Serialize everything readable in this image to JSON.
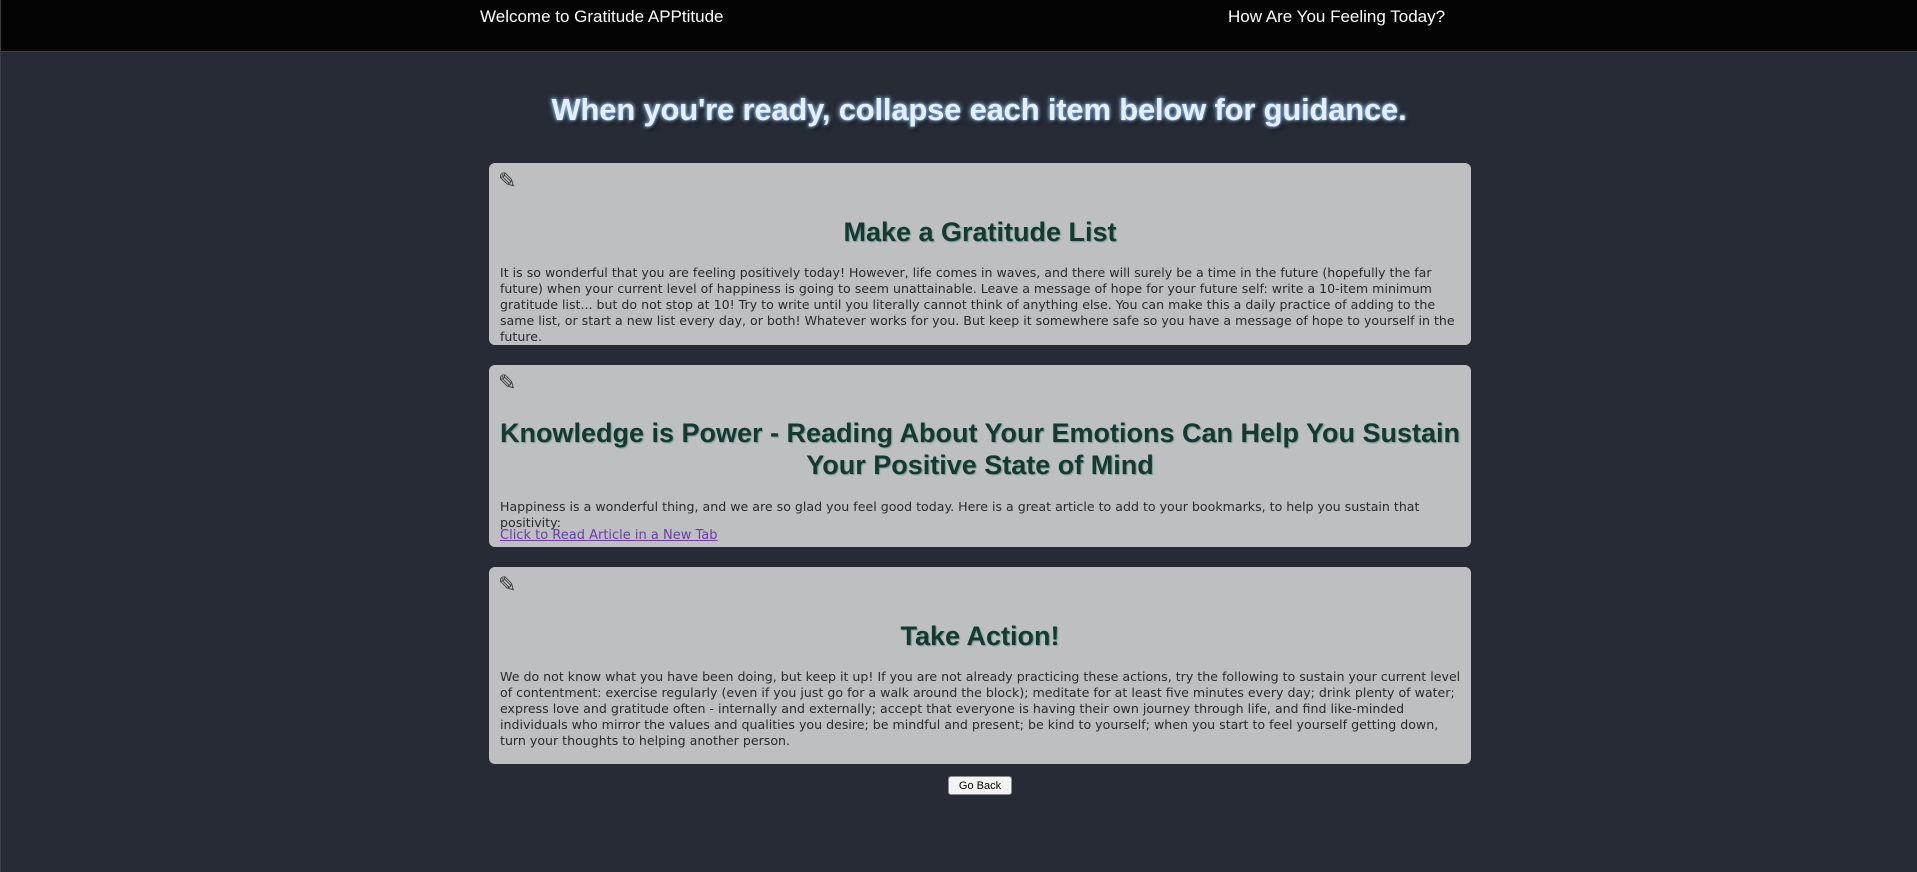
{
  "nav": {
    "home_label": "Welcome to Gratitude APPtitude",
    "feeling_label": "How Are You Feeling Today?"
  },
  "headline": "When you're ready, collapse each item below for guidance.",
  "icons": {
    "card_toggle": "pencil-icon"
  },
  "cards": [
    {
      "title": "Make a Gratitude List",
      "body": "It is so wonderful that you are feeling positively today! However, life comes in waves, and there will surely be a time in the future (hopefully the far future) when your current level of happiness is going to seem unattainable. Leave a message of hope for your future self: write a 10-item minimum gratitude list... but do not stop at 10! Try to write until you literally cannot think of anything else. You can make this a daily practice of adding to the same list, or start a new list every day, or both! Whatever works for you. But keep it somewhere safe so you have a message of hope to yourself in the future."
    },
    {
      "title": "Knowledge is Power - Reading About Your Emotions Can Help You Sustain Your Positive State of Mind",
      "body": "Happiness is a wonderful thing, and we are so glad you feel good today. Here is a great article to add to your bookmarks, to help you sustain that positivity:",
      "link_label": "Click to Read Article in a New Tab"
    },
    {
      "title": "Take Action!",
      "body": "We do not know what you have been doing, but keep it up! If you are not already practicing these actions, try the following to sustain your current level of contentment: exercise regularly (even if you just go for a walk around the block); meditate for at least five minutes every day; drink plenty of water; express love and gratitude often - internally and externally; accept that everyone is having their own journey through life, and find like-minded individuals who mirror the values and qualities you desire; be mindful and present; be kind to yourself; when you start to feel yourself getting down, turn your thoughts to helping another person."
    }
  ],
  "back_button_label": "Go Back",
  "colors": {
    "page_bg": "#272b35",
    "topbar_bg": "#040404",
    "card_bg": "#bebfc0",
    "card_title": "#163832",
    "link": "#6a3da8"
  }
}
